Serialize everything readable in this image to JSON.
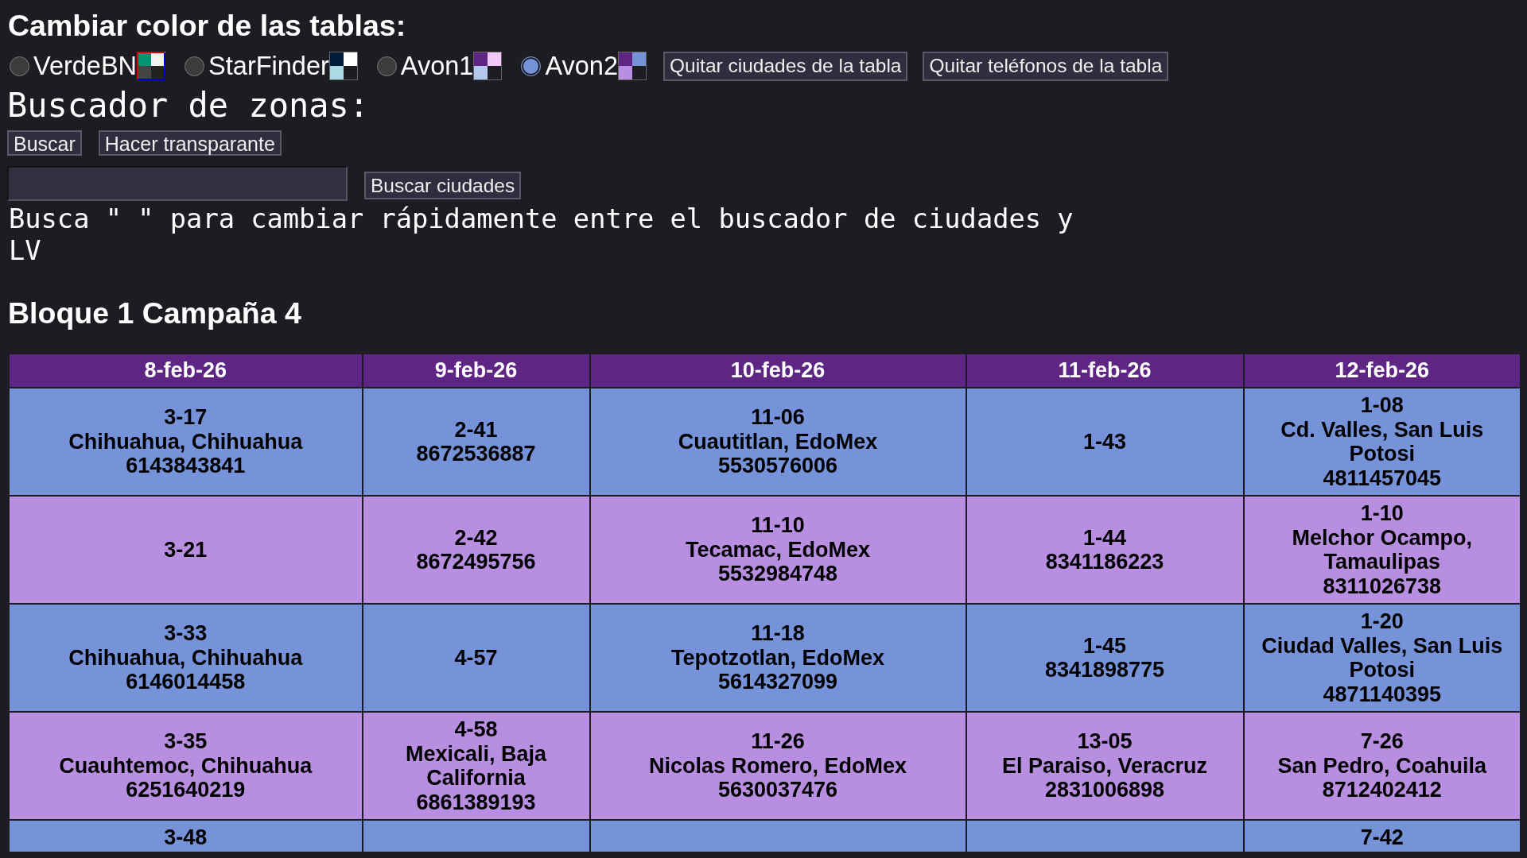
{
  "theme_picker": {
    "title": "Cambiar color de las tablas:",
    "themes": [
      {
        "label": "VerdeBN",
        "selected": false,
        "swatch": [
          {
            "color": "#009473"
          },
          {
            "color": "#f2f2f2"
          },
          {
            "color": "#444444"
          },
          {
            "color": "#222222"
          }
        ],
        "frame": [
          {
            "color": "#e00000"
          },
          {
            "color": "#0000d0"
          }
        ]
      },
      {
        "label": "StarFinder",
        "selected": false,
        "swatch": [
          {
            "color": "#001a3a"
          },
          {
            "color": "#ffffff"
          },
          {
            "color": "#add8e6"
          },
          {
            "color": "#1c1c22"
          }
        ]
      },
      {
        "label": "Avon1",
        "selected": false,
        "swatch": [
          {
            "color": "#5e2585"
          },
          {
            "color": "#f2c8f8"
          },
          {
            "color": "#b2c8ec"
          },
          {
            "color": "#1c1c22"
          }
        ]
      },
      {
        "label": "Avon2",
        "selected": true,
        "swatch": [
          {
            "color": "#5e2585"
          },
          {
            "color": "#7692d9"
          },
          {
            "color": "#b88fe0"
          },
          {
            "color": "#1c1c22"
          }
        ]
      }
    ],
    "buttons": [
      "Quitar ciudades de la tabla",
      "Quitar teléfonos de la tabla"
    ]
  },
  "zone_finder": {
    "title": "Buscador de zonas:",
    "buttons": [
      "Buscar",
      "Hacer transparante"
    ],
    "search_button": "Buscar ciudades",
    "hint": "Busca \" \" para cambiar rápidamente entre el buscador de ciudades y LV"
  },
  "schedule": {
    "title": "Bloque 1 Campaña 4",
    "columns": [
      "8-feb-26",
      "9-feb-26",
      "10-feb-26",
      "11-feb-26",
      "12-feb-26"
    ],
    "rows": [
      [
        {
          "zone": "3-17",
          "city": "Chihuahua, Chihuahua",
          "phone": "6143843841"
        },
        {
          "zone": "2-41",
          "phone": "8672536887"
        },
        {
          "zone": "11-06",
          "city": "Cuautitlan, EdoMex",
          "phone": "5530576006"
        },
        {
          "zone": "1-43"
        },
        {
          "zone": "1-08",
          "city": "Cd. Valles, San Luis Potosi",
          "phone": "4811457045"
        }
      ],
      [
        {
          "zone": "3-21"
        },
        {
          "zone": "2-42",
          "phone": "8672495756"
        },
        {
          "zone": "11-10",
          "city": "Tecamac, EdoMex",
          "phone": "5532984748"
        },
        {
          "zone": "1-44",
          "phone": "8341186223"
        },
        {
          "zone": "1-10",
          "city": "Melchor Ocampo, Tamaulipas",
          "phone": "8311026738"
        }
      ],
      [
        {
          "zone": "3-33",
          "city": "Chihuahua, Chihuahua",
          "phone": "6146014458"
        },
        {
          "zone": "4-57"
        },
        {
          "zone": "11-18",
          "city": "Tepotzotlan, EdoMex",
          "phone": "5614327099"
        },
        {
          "zone": "1-45",
          "phone": "8341898775"
        },
        {
          "zone": "1-20",
          "city": "Ciudad Valles, San Luis Potosi",
          "phone": "4871140395"
        }
      ],
      [
        {
          "zone": "3-35",
          "city": "Cuauhtemoc, Chihuahua",
          "phone": "6251640219"
        },
        {
          "zone": "4-58",
          "city": "Mexicali, Baja California",
          "phone": "6861389193"
        },
        {
          "zone": "11-26",
          "city": "Nicolas Romero, EdoMex",
          "phone": "5630037476"
        },
        {
          "zone": "13-05",
          "city": "El Paraiso, Veracruz",
          "phone": "2831006898"
        },
        {
          "zone": "7-26",
          "city": "San Pedro, Coahuila",
          "phone": "8712402412"
        }
      ],
      [
        {
          "zone": "3-48"
        },
        null,
        null,
        null,
        {
          "zone": "7-42"
        }
      ]
    ]
  }
}
